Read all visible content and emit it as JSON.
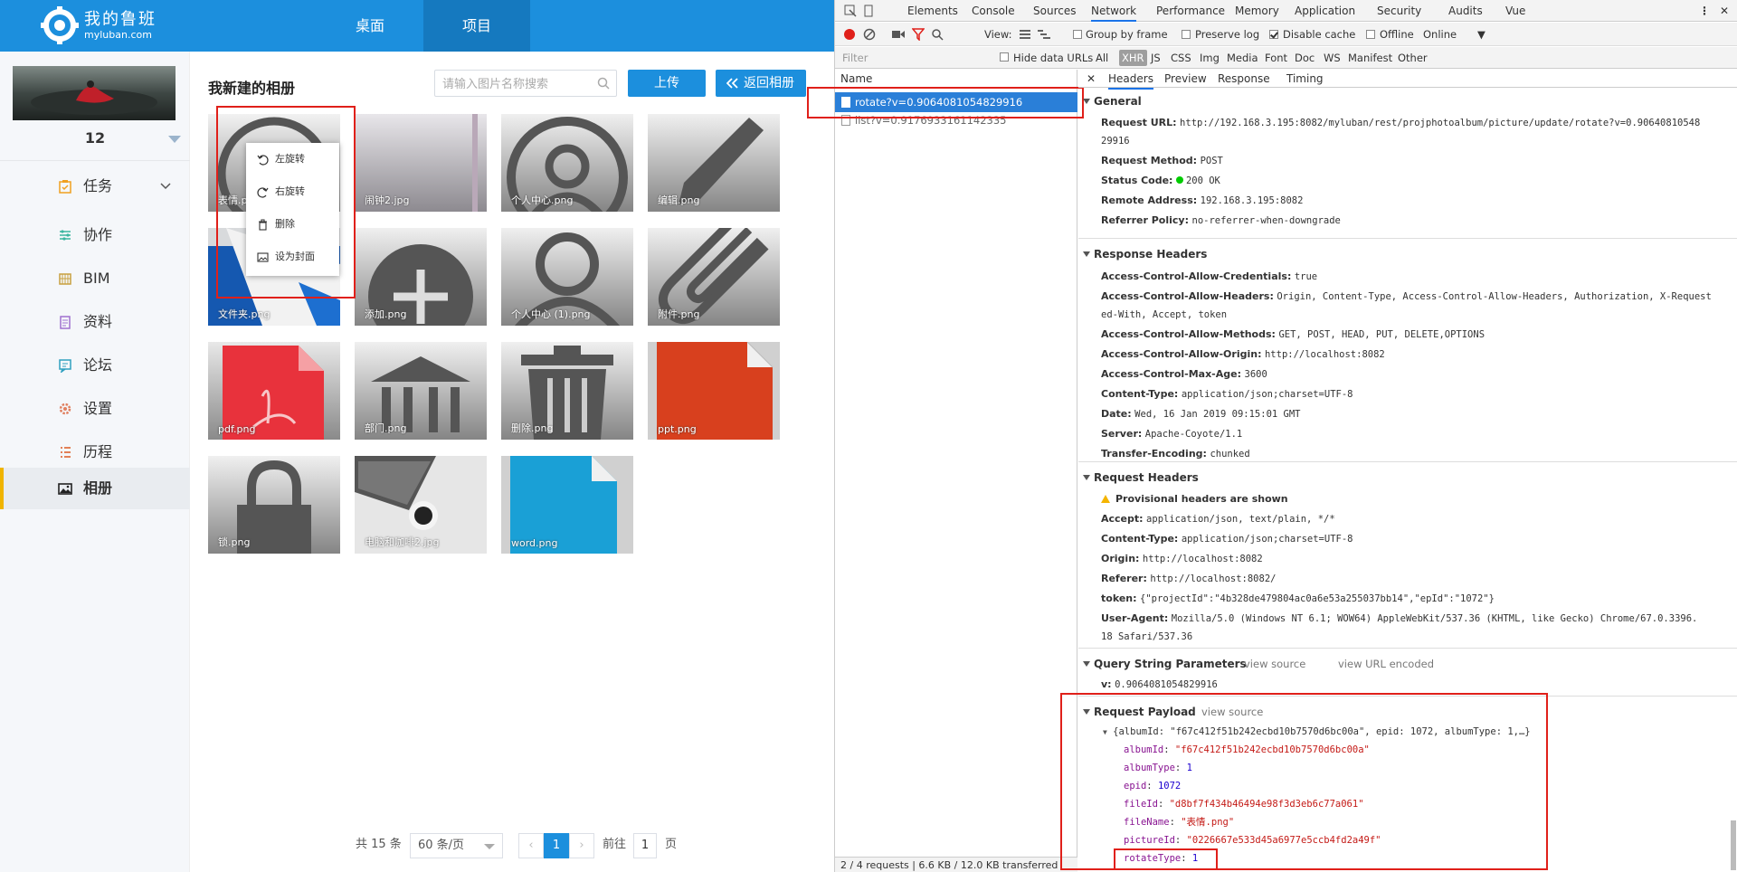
{
  "app": {
    "brand_title": "我的鲁班",
    "brand_sub": "myluban.com",
    "nav": [
      "桌面",
      "项目"
    ],
    "user": {
      "name": "12"
    },
    "menu": [
      {
        "label": "任务",
        "icon": "task-icon",
        "color": "#f0a020"
      },
      {
        "label": "协作",
        "icon": "collab-icon",
        "color": "#3bb6a0"
      },
      {
        "label": "BIM",
        "icon": "bim-icon",
        "color": "#c8a040"
      },
      {
        "label": "资料",
        "icon": "docs-icon",
        "color": "#a070d0"
      },
      {
        "label": "论坛",
        "icon": "forum-icon",
        "color": "#30a0c0"
      },
      {
        "label": "设置",
        "icon": "gear-icon",
        "color": "#e08060"
      },
      {
        "label": "历程",
        "icon": "history-icon",
        "color": "#e07040"
      },
      {
        "label": "相册",
        "icon": "album-icon",
        "color": "#333333"
      }
    ],
    "active_menu": "相册",
    "page_title": "我新建的相册",
    "search_placeholder": "请输入图片名称搜索",
    "upload_label": "上传",
    "back_label": "返回相册",
    "tiles": [
      {
        "name": "表情.png"
      },
      {
        "name": "闹钟2.jpg"
      },
      {
        "name": "个人中心.png"
      },
      {
        "name": "编辑.png"
      },
      {
        "name": "文件夹.png"
      },
      {
        "name": "添加.png"
      },
      {
        "name": "个人中心 (1).png"
      },
      {
        "name": "附件.png"
      },
      {
        "name": "pdf.png"
      },
      {
        "name": "部门.png"
      },
      {
        "name": "删除.png"
      },
      {
        "name": "ppt.png"
      },
      {
        "name": "锁.png"
      },
      {
        "name": "电脑和咖啡2.jpg"
      },
      {
        "name": "word.png"
      }
    ],
    "context_menu": [
      "左旋转",
      "右旋转",
      "删除",
      "设为封面"
    ],
    "pagination": {
      "total": "共 15 条",
      "page_size": "60 条/页",
      "current": "1",
      "goto_label": "前往",
      "goto_value": "1",
      "page_suffix": "页"
    }
  },
  "devtools": {
    "tabs": [
      "Elements",
      "Console",
      "Sources",
      "Network",
      "Performance",
      "Memory",
      "Application",
      "Security",
      "Audits",
      "Vue"
    ],
    "active_tab": "Network",
    "toolbar": {
      "view": "View:",
      "group_by_frame": "Group by frame",
      "preserve_log": "Preserve log",
      "disable_cache": "Disable cache",
      "offline": "Offline",
      "online": "Online"
    },
    "filter": {
      "placeholder": "Filter",
      "hide_data_urls": "Hide data URLs",
      "types": [
        "All",
        "XHR",
        "JS",
        "CSS",
        "Img",
        "Media",
        "Font",
        "Doc",
        "WS",
        "Manifest",
        "Other"
      ],
      "active": "XHR"
    },
    "name_header": "Name",
    "requests": [
      "rotate?v=0.9064081054829916",
      "list?v=0.9176933161142335"
    ],
    "status": "2 / 4 requests | 6.6 KB / 12.0 KB transferred",
    "detail_tabs": [
      "Headers",
      "Preview",
      "Response",
      "Timing"
    ],
    "general": {
      "title": "General",
      "url_k": "Request URL:",
      "url_v1": "http://192.168.3.195:8082/myluban/rest/projphotoalbum/picture/update/rotate?v=0.90640810548",
      "url_v2": "29916",
      "method_k": "Request Method:",
      "method_v": "POST",
      "status_k": "Status Code:",
      "status_v": "200 OK",
      "remote_k": "Remote Address:",
      "remote_v": "192.168.3.195:8082",
      "referrer_k": "Referrer Policy:",
      "referrer_v": "no-referrer-when-downgrade"
    },
    "response_headers": {
      "title": "Response Headers",
      "rows": [
        [
          "Access-Control-Allow-Credentials:",
          "true"
        ],
        [
          "Access-Control-Allow-Headers:",
          "Origin, Content-Type, Access-Control-Allow-Headers, Authorization, X-Request"
        ],
        [
          "",
          "ed-With, Accept, token"
        ],
        [
          "Access-Control-Allow-Methods:",
          "GET, POST, HEAD, PUT, DELETE,OPTIONS"
        ],
        [
          "Access-Control-Allow-Origin:",
          "http://localhost:8082"
        ],
        [
          "Access-Control-Max-Age:",
          "3600"
        ],
        [
          "Content-Type:",
          "application/json;charset=UTF-8"
        ],
        [
          "Date:",
          "Wed, 16 Jan 2019 09:15:01 GMT"
        ],
        [
          "Server:",
          "Apache-Coyote/1.1"
        ],
        [
          "Transfer-Encoding:",
          "chunked"
        ]
      ]
    },
    "request_headers": {
      "title": "Request Headers",
      "provisional": "Provisional headers are shown",
      "rows": [
        [
          "Accept:",
          "application/json, text/plain, */*"
        ],
        [
          "Content-Type:",
          "application/json;charset=UTF-8"
        ],
        [
          "Origin:",
          "http://localhost:8082"
        ],
        [
          "Referer:",
          "http://localhost:8082/"
        ],
        [
          "token:",
          "{\"projectId\":\"4b328de479804ac0a6e53a255037bb14\",\"epId\":\"1072\"}"
        ],
        [
          "User-Agent:",
          "Mozilla/5.0 (Windows NT 6.1; WOW64) AppleWebKit/537.36 (KHTML, like Gecko) Chrome/67.0.3396."
        ],
        [
          "",
          "18 Safari/537.36"
        ]
      ]
    },
    "query": {
      "title": "Query String Parameters",
      "view_source": "view source",
      "view_url": "view URL encoded",
      "k": "v:",
      "v": "0.9064081054829916"
    },
    "payload": {
      "title": "Request Payload",
      "view_source": "view source",
      "summary": "{albumId: \"f67c412f51b242ecbd10b7570d6bc00a\", epid: 1072, albumType: 1,…}",
      "rows": [
        [
          "albumId",
          "\"f67c412f51b242ecbd10b7570d6bc00a\"",
          "s"
        ],
        [
          "albumType",
          "1",
          "n"
        ],
        [
          "epid",
          "1072",
          "n"
        ],
        [
          "fileId",
          "\"d8bf7f434b46494e98f3d3eb6c77a061\"",
          "s"
        ],
        [
          "fileName",
          "\"表情.png\"",
          "s"
        ],
        [
          "pictureId",
          "\"0226667e533d45a6977e5ccb4fd2a49f\"",
          "s"
        ],
        [
          "rotateType",
          "1",
          "n"
        ]
      ]
    }
  }
}
